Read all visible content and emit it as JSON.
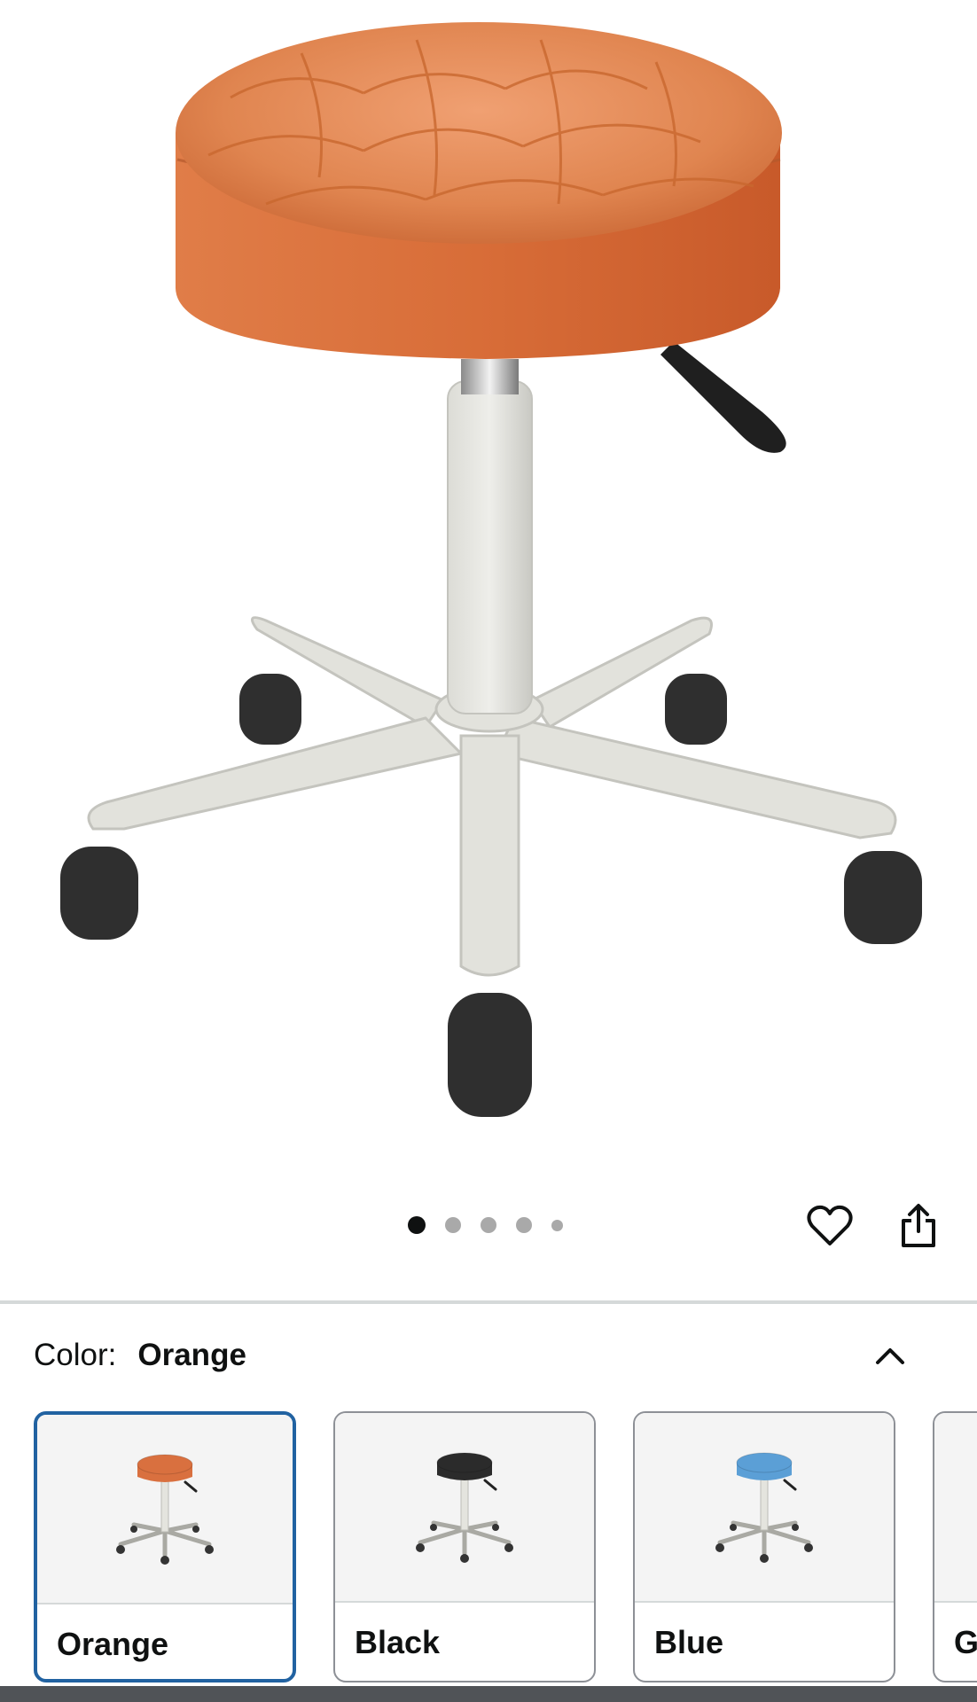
{
  "product": {
    "seat_color_hex": "#d9703f",
    "icons": {
      "wishlist": "heart-outline-icon",
      "share": "share-icon",
      "collapse": "chevron-up-icon"
    }
  },
  "gallery": {
    "image_count": 5,
    "current_index": 1
  },
  "variation": {
    "label": "Color:",
    "selected_value": "Orange",
    "options": [
      {
        "label": "Orange",
        "seat_hex": "#d9703f",
        "selected": true
      },
      {
        "label": "Black",
        "seat_hex": "#2b2b2b",
        "selected": false
      },
      {
        "label": "Blue",
        "seat_hex": "#5b9fd6",
        "selected": false
      },
      {
        "label": "G",
        "seat_hex": "#9a9a9a",
        "selected": false
      }
    ]
  },
  "colors": {
    "selected_border": "#2162a1",
    "swatch_border": "#8d9096"
  }
}
